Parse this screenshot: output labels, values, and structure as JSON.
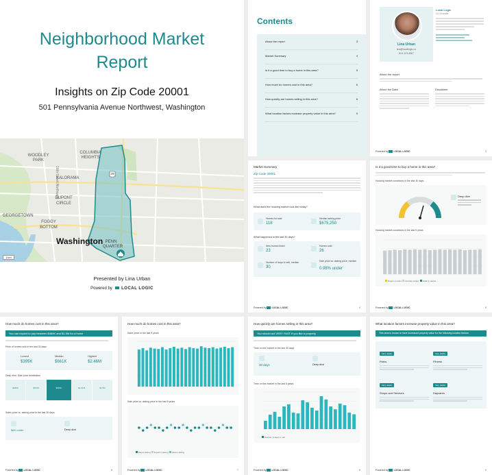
{
  "cover": {
    "title_line1": "Neighborhood Market",
    "title_line2": "Report",
    "subtitle": "Insights on Zip Code 20001",
    "address": "501 Pennsylvania Avenue Northwest, Washington",
    "presented_by": "Presented by Lina Urban",
    "powered_by": "Powered by",
    "brand": "LOCAL LOGIC",
    "map_labels": {
      "woodley_park": "WOODLEY PARK",
      "columbia_heights": "COLUMBIA HEIGHTS",
      "kalorama": "KALORAMA",
      "dupont_circle": "DUPONT CIRCLE",
      "georgetown": "GEORGETOWN",
      "foggy_bottom": "FOGGY BOTTOM",
      "city": "Washington",
      "penn_quarter": "PENN QUARTER",
      "street": "16th Street Northwest",
      "route_shield": "29",
      "scale": "1 km"
    }
  },
  "contents": {
    "heading": "Contents",
    "items": [
      {
        "label": "About the report",
        "page": "3"
      },
      {
        "label": "Market Summary",
        "page": "4"
      },
      {
        "label": "Is it a good time to buy a home in this area?",
        "page": "5"
      },
      {
        "label": "How much do homes cost in this area?",
        "page": "6"
      },
      {
        "label": "How quickly are homes selling in this area?",
        "page": "8"
      },
      {
        "label": "What location factors increase property value in this area?",
        "page": "9"
      }
    ]
  },
  "agent": {
    "name": "Lina Urban",
    "email": "lina@locallogic.co",
    "phone": "514-123-4567",
    "company": "Local Logic",
    "role": "Co-Founder",
    "sections": [
      "About the report",
      "About the Data",
      "Disclaimer"
    ]
  },
  "market_summary": {
    "heading": "Market Summary",
    "zip_title": "Zip Code 20001",
    "q1": "What does the housing market look like today?",
    "q2": "What happened in the last 30 days?",
    "homes_for_sale_label": "Homes for sale",
    "homes_for_sale": "118",
    "median_price_label": "Median asking price",
    "median_price": "$675,250",
    "new_homes_label": "New homes listed",
    "new_homes": "23",
    "homes_sold_label": "Homes sold",
    "homes_sold": "26",
    "days_to_sell_label": "Number of days to sell, median",
    "days_to_sell": "30",
    "sale_vs_ask_label": "Sale price vs. asking price, median",
    "sale_vs_ask": "0.98% under"
  },
  "good_time": {
    "heading": "Is it a good time to buy a home in this area?",
    "chart1_title": "Housing market conditions in the last 30 days",
    "gauge_label": "Deep dive",
    "chart2_title": "Housing market conditions in the last 5 years",
    "legend": [
      "Buyer's market",
      "Neutral market",
      "Seller's market"
    ]
  },
  "cost": {
    "heading": "How much do homes cost in this area?",
    "banner": "You can expect to pay between $484K and $1.5M for a home",
    "range_title": "Price of homes sold in the last 30 days",
    "lowest_label": "Lowest",
    "lowest": "$395K",
    "median_label": "Median",
    "median": "$661K",
    "highest_label": "Highest",
    "highest": "$2.46M",
    "dist_title": "Deep dive: Sale price distribution",
    "dist_values": [
      "$484K",
      "$531K",
      "$661K",
      "$1.01M",
      "$1.5M"
    ],
    "sale_vs_ask_title": "Sales price vs. asking price in the last 30 days",
    "under_value": "$6K under",
    "deep_dive": "Deep dive"
  },
  "cost2": {
    "heading": "How much do homes cost in this area?",
    "chart1_title": "Sales price in the last 5 years",
    "chart2_title": "Sale price vs. asking price in the last 5 years",
    "legend": [
      "Below asking",
      "Equal to asking",
      "Above asking"
    ]
  },
  "speed": {
    "heading": "How quickly are homes selling in this area?",
    "banner": "You should act VERY FAST if you like a property",
    "card_title": "Time on the market in the last 30 days",
    "days_value": "30 days",
    "deep_dive": "Deep dive",
    "chart_title": "Time on the market in the last 5 years",
    "legend": [
      "Number of days to sell"
    ]
  },
  "location": {
    "heading": "What location factors increase property value in this area?",
    "banner": "This area is known to have increased property value for the following location factors",
    "factors": [
      {
        "tag": "Very useful",
        "name": "Parks"
      },
      {
        "tag": "Very useful",
        "name": "Fitness"
      },
      {
        "tag": "Very useful",
        "name": "Shops and Services"
      },
      {
        "tag": "Very useful",
        "name": "Daycares"
      }
    ]
  },
  "footer": {
    "powered": "Powered by",
    "brand": "LOCAL LOGIC"
  },
  "page_numbers": [
    "3",
    "4",
    "5",
    "6",
    "7",
    "8",
    "9"
  ],
  "chart_data": [
    {
      "type": "bar",
      "title": "Housing market conditions in the last 5 years",
      "values": [
        55,
        56,
        57,
        56,
        58,
        57,
        58,
        57,
        58,
        56,
        57,
        58,
        57,
        58,
        57,
        58,
        56,
        57,
        57,
        58
      ]
    },
    {
      "type": "bar",
      "title": "Sales price in the last 5 years",
      "values": [
        82,
        85,
        80,
        86,
        84,
        83,
        87,
        82,
        85,
        88,
        84,
        86,
        83,
        87,
        85,
        84,
        89,
        86,
        85,
        87,
        84,
        86,
        88,
        85,
        87
      ]
    },
    {
      "type": "scatter",
      "title": "Sale price vs. asking price in the last 5 years",
      "values": [
        0,
        -1,
        0,
        1,
        0,
        0,
        -1,
        0,
        1,
        0,
        0,
        1,
        0,
        -1,
        0,
        0,
        1,
        0,
        0,
        -1,
        0,
        1,
        0,
        0
      ]
    },
    {
      "type": "bar",
      "title": "Time on the market in the last 5 years",
      "values": [
        20,
        35,
        42,
        30,
        55,
        60,
        40,
        38,
        70,
        65,
        52,
        45,
        80,
        72,
        55,
        48,
        62,
        58,
        40,
        36
      ]
    }
  ]
}
